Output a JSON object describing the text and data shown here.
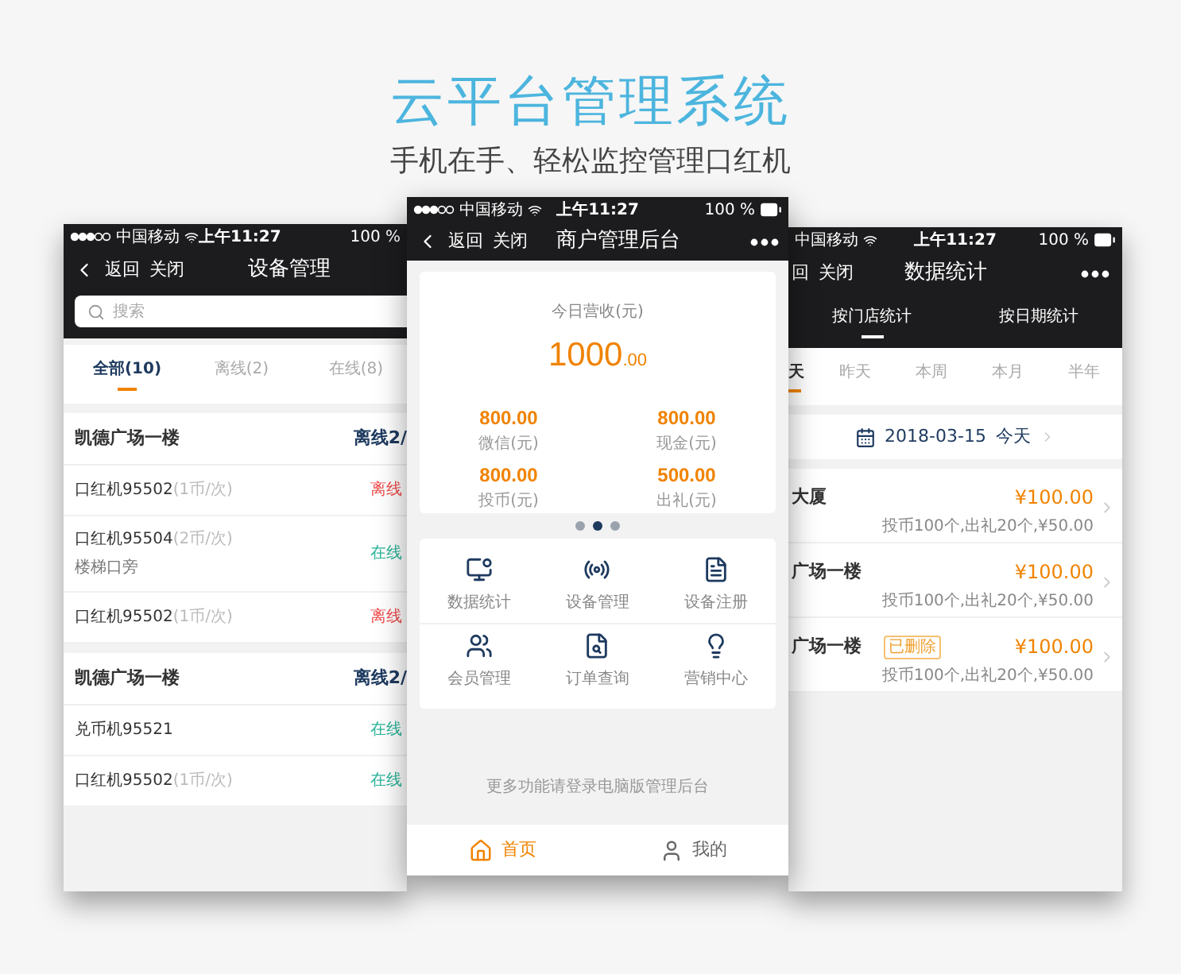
{
  "heading": {
    "title": "云平台管理系统",
    "subtitle": "手机在手、轻松监控管理口红机"
  },
  "left_phone": {
    "status_bar": {
      "carrier": "中国移动",
      "time": "上午11:27",
      "battery": "100 %"
    },
    "nav": {
      "back": "返回",
      "close": "关闭",
      "title": "设备管理"
    },
    "search": {
      "placeholder": "搜索"
    },
    "tabs": [
      {
        "label": "全部(10)",
        "selected": true
      },
      {
        "label": "离线(2)",
        "selected": false
      },
      {
        "label": "在线(8)",
        "selected": false
      }
    ],
    "groups": [
      {
        "name": "凯德广场一楼",
        "summary": "离线2/",
        "devices": [
          {
            "name": "口红机95502",
            "rate": "(1币/次)",
            "status": "离线",
            "online": false
          },
          {
            "name": "口红机95504",
            "rate": "(2币/次)",
            "location": "楼梯口旁",
            "status": "在线",
            "online": true
          },
          {
            "name": "口红机95502",
            "rate": "(1币/次)",
            "status": "离线",
            "online": false
          }
        ]
      },
      {
        "name": "凯德广场一楼",
        "summary": "离线2/",
        "devices": [
          {
            "name": "兑币机95521",
            "status": "在线",
            "online": true
          },
          {
            "name": "口红机95502",
            "rate": "(1币/次)",
            "status": "在线",
            "online": true
          }
        ]
      }
    ]
  },
  "center_phone": {
    "status_bar": {
      "carrier": "中国移动",
      "time": "上午11:27",
      "battery": "100 %"
    },
    "nav": {
      "back": "返回",
      "close": "关闭",
      "title": "商户管理后台"
    },
    "revenue": {
      "label": "今日营收(元)",
      "amount": "1000",
      "decimals": ".00"
    },
    "stats": [
      {
        "value": "800.00",
        "label": "微信(元)"
      },
      {
        "value": "800.00",
        "label": "现金(元)"
      },
      {
        "value": "800.00",
        "label": "投币(元)"
      },
      {
        "value": "500.00",
        "label": "出礼(元)"
      }
    ],
    "pages": [
      {
        "selected": false
      },
      {
        "selected": true
      },
      {
        "selected": false
      }
    ],
    "menu": [
      {
        "label": "数据统计"
      },
      {
        "label": "设备管理"
      },
      {
        "label": "设备注册"
      },
      {
        "label": "会员管理"
      },
      {
        "label": "订单查询"
      },
      {
        "label": "营销中心"
      }
    ],
    "note": "更多功能请登录电脑版管理后台",
    "tab_bar": [
      {
        "label": "首页",
        "selected": true
      },
      {
        "label": "我的",
        "selected": false
      }
    ]
  },
  "right_phone": {
    "status_bar": {
      "carrier": "中国移动",
      "time": "上午11:27",
      "battery": "100 %"
    },
    "nav": {
      "back": "回",
      "close": "关闭",
      "title": "数据统计"
    },
    "tabs": [
      {
        "label": "按门店统计",
        "selected": true
      },
      {
        "label": "按日期统计",
        "selected": false
      }
    ],
    "periods": [
      {
        "label": "天",
        "selected": true
      },
      {
        "label": "昨天",
        "selected": false
      },
      {
        "label": "本周",
        "selected": false
      },
      {
        "label": "本月",
        "selected": false
      },
      {
        "label": "半年",
        "selected": false
      }
    ],
    "date": {
      "date": "2018-03-15",
      "day": "今天"
    },
    "stores": [
      {
        "name": "大厦",
        "amount": "¥100.00",
        "detail": "投币100个,出礼20个,¥50.00"
      },
      {
        "name": "广场一楼",
        "amount": "¥100.00",
        "detail": "投币100个,出礼20个,¥50.00"
      },
      {
        "name": "广场一楼",
        "tag": "已删除",
        "amount": "¥100.00",
        "detail": "投币100个,出礼20个,¥50.00"
      }
    ]
  }
}
